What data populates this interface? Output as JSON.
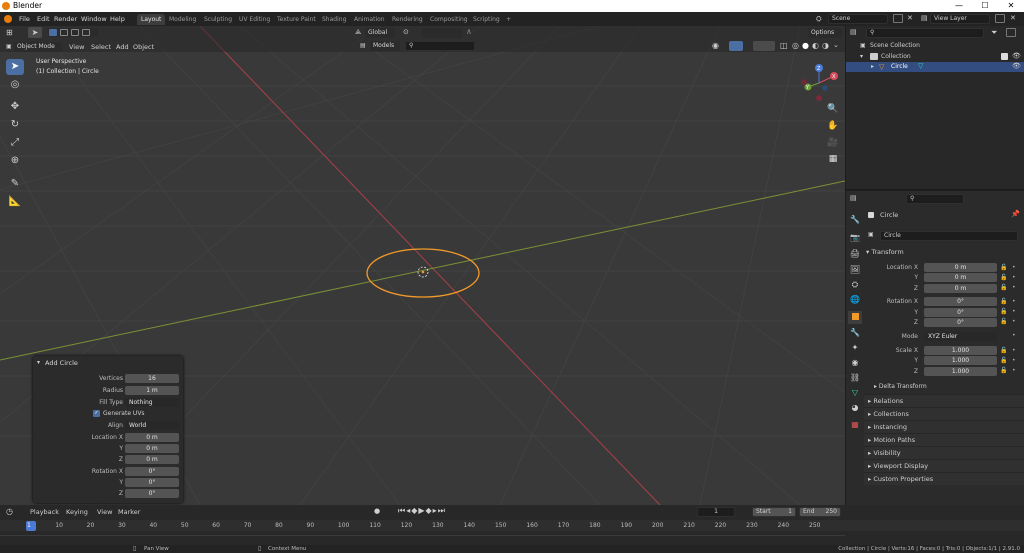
{
  "window": {
    "title": "Blender",
    "min": "—",
    "max": "☐",
    "close": "✕"
  },
  "menu": [
    "File",
    "Edit",
    "Render",
    "Window",
    "Help"
  ],
  "workspaces": [
    {
      "label": "Layout",
      "active": true
    },
    {
      "label": "Modeling"
    },
    {
      "label": "Sculpting"
    },
    {
      "label": "UV Editing"
    },
    {
      "label": "Texture Paint"
    },
    {
      "label": "Shading"
    },
    {
      "label": "Animation"
    },
    {
      "label": "Rendering"
    },
    {
      "label": "Compositing"
    },
    {
      "label": "Scripting"
    }
  ],
  "add_workspace": "+",
  "scene": {
    "name": "Scene",
    "view_layer": "View Layer"
  },
  "viewport_header": {
    "mode": "Object Mode",
    "menus": [
      "View",
      "Select",
      "Add",
      "Object"
    ],
    "orientation": "Global",
    "models": "Models",
    "options": "Options"
  },
  "viewport_overlay": {
    "line1": "User Perspective",
    "line2": "(1) Collection | Circle"
  },
  "gizmo": {
    "x": "X",
    "y": "Y",
    "z": "Z"
  },
  "op_panel": {
    "title": "Add Circle",
    "rows": [
      {
        "label": "Vertices",
        "value": "16"
      },
      {
        "label": "Radius",
        "value": "1 m"
      },
      {
        "label": "Fill Type",
        "value": "Nothing"
      },
      {
        "label": "",
        "value": "Generate UVs"
      },
      {
        "label": "Align",
        "value": "World"
      },
      {
        "label": "Location X",
        "value": "0 m"
      },
      {
        "label": "Y",
        "value": "0 m"
      },
      {
        "label": "Z",
        "value": "0 m"
      },
      {
        "label": "Rotation X",
        "value": "0°"
      },
      {
        "label": "Y",
        "value": "0°"
      },
      {
        "label": "Z",
        "value": "0°"
      }
    ]
  },
  "outliner": {
    "root": "Scene Collection",
    "collection": "Collection",
    "object": "Circle"
  },
  "properties": {
    "object_name": "Circle",
    "data_name": "Circle",
    "transform_title": "Transform",
    "location": {
      "label_x": "Location X",
      "label_y": "Y",
      "label_z": "Z",
      "x": "0 m",
      "y": "0 m",
      "z": "0 m"
    },
    "rotation": {
      "label_x": "Rotation X",
      "label_y": "Y",
      "label_z": "Z",
      "x": "0°",
      "y": "0°",
      "z": "0°"
    },
    "mode": {
      "label": "Mode",
      "value": "XYZ Euler"
    },
    "scale": {
      "label_x": "Scale X",
      "label_y": "Y",
      "label_z": "Z",
      "x": "1.000",
      "y": "1.000",
      "z": "1.000"
    },
    "sections": [
      "Delta Transform",
      "Relations",
      "Collections",
      "Instancing",
      "Motion Paths",
      "Visibility",
      "Viewport Display",
      "Custom Properties"
    ]
  },
  "timeline": {
    "menus": [
      "Playback",
      "Keying",
      "View",
      "Marker"
    ],
    "current_frame": "1",
    "start_label": "Start",
    "start": "1",
    "end_label": "End",
    "end": "250",
    "ticks": [
      "1",
      "10",
      "20",
      "30",
      "40",
      "50",
      "60",
      "70",
      "80",
      "90",
      "100",
      "110",
      "120",
      "130",
      "140",
      "150",
      "160",
      "170",
      "180",
      "190",
      "200",
      "210",
      "220",
      "230",
      "240",
      "250"
    ]
  },
  "status": {
    "pan": "Pan View",
    "context": "Context Menu",
    "stats": "Collection | Circle | Verts:16 | Faces:0 | Tris:0 | Objects:1/1 | 2.91.0"
  }
}
